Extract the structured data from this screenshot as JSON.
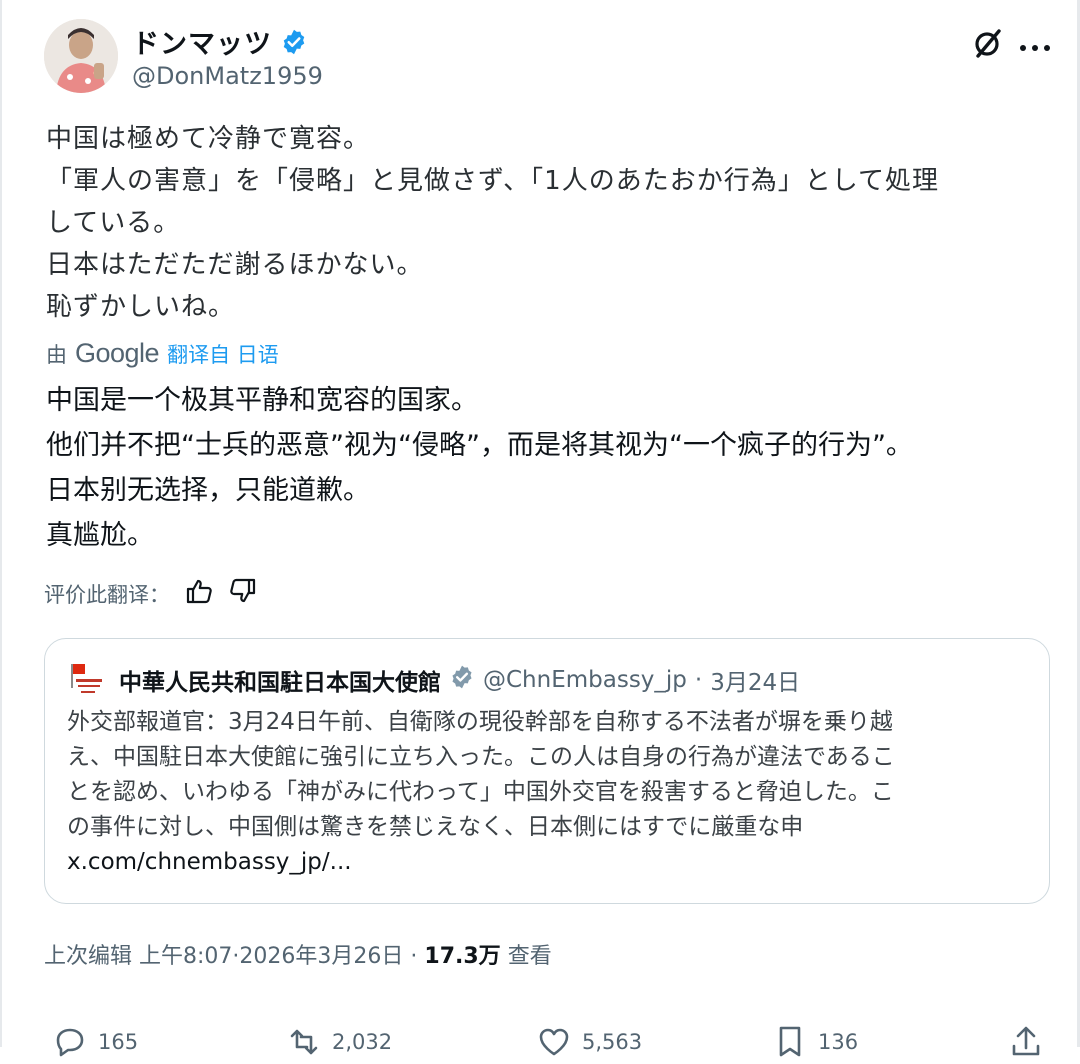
{
  "author": {
    "display_name": "ドンマッツ",
    "handle": "@DonMatz1959",
    "verified_icon": "verified-badge-icon"
  },
  "header_icons": [
    "grok-icon",
    "more-icon"
  ],
  "tweet": {
    "lines": [
      "中国は極めて冷静で寛容。",
      "「軍人の害意」を「侵略」と見做さず、「1人のあたおか行為」として処理",
      "している。",
      "日本はただただ謝るほかない。",
      "恥ずかしいね。"
    ]
  },
  "translation": {
    "prefix": "由",
    "provider": "Google",
    "link_text": "翻译自 日语",
    "lines": [
      "中国是一个极其平静和宽容的国家。",
      "他们并不把“士兵的恶意”视为“侵略”，而是将其视为“一个疯子的行为”。",
      "日本别无选择，只能道歉。",
      "真尴尬。"
    ],
    "rate_label": "评价此翻译："
  },
  "quote": {
    "name": "中華人民共和国駐日本国大使館",
    "handle": "@ChnEmbassy_jp",
    "separator": "·",
    "date": "3月24日",
    "lines": [
      "外交部報道官：3月24日午前、自衛隊の現役幹部を自称する不法者が塀を乗り越",
      "え、中国駐日本大使館に強引に立ち入った。この人は自身の行為が違法であるこ",
      "とを認め、いわゆる「神がみに代わって」中国外交官を殺害すると脅迫した。こ",
      "の事件に対し、中国側は驚きを禁じえなく、日本側にはすでに厳重な申"
    ],
    "link": "x.com/chnembassy_jp/..."
  },
  "meta": {
    "edited_label": "上次编辑",
    "time": "上午8:07",
    "date": "2026年3月26日",
    "separator": "·",
    "views_count": "17.3万",
    "views_label": "查看"
  },
  "actions": {
    "reply_count": "165",
    "repost_count": "2,032",
    "like_count": "5,563",
    "bookmark_count": "136"
  },
  "colors": {
    "accent": "#1d9bf0",
    "secondary_text": "#536471",
    "border": "#cfd9de"
  }
}
